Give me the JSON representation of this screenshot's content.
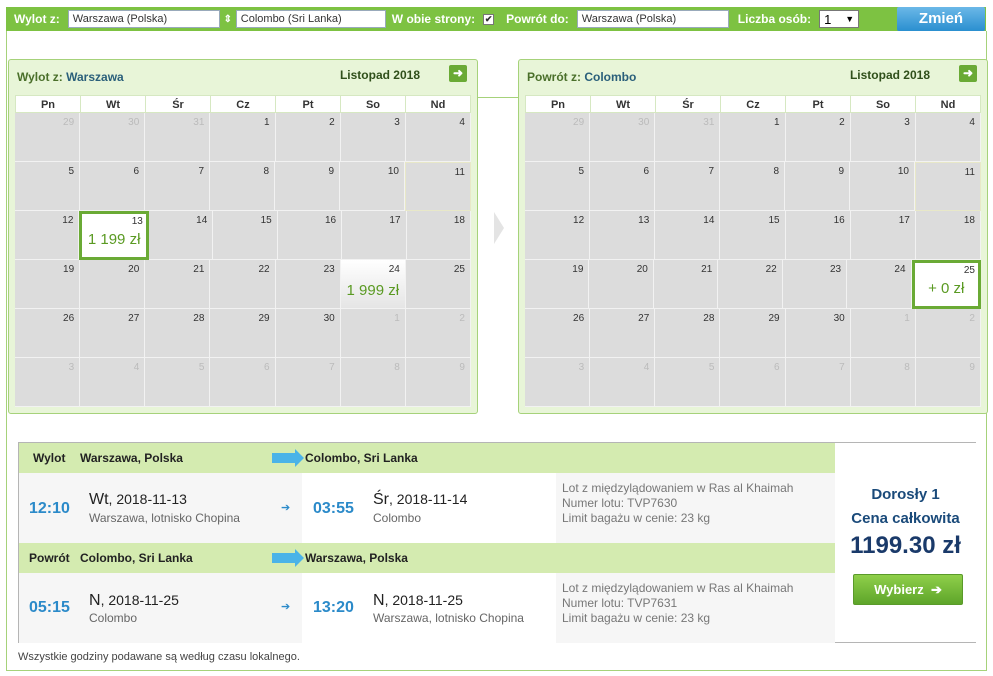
{
  "search": {
    "from_label": "Wylot z:",
    "from_value": "Warszawa (Polska)",
    "to_value": "Colombo (Sri Lanka)",
    "roundtrip_label": "W obie strony:",
    "return_label": "Powrót do:",
    "return_value": "Warszawa (Polska)",
    "persons_label": "Liczba osób:",
    "persons_value": "1",
    "submit_label": "Zmień"
  },
  "cal_out": {
    "title_prefix": "Wylot z: ",
    "title_city": "Warszawa",
    "month": "Listopad 2018",
    "days": [
      "Pn",
      "Wt",
      "Śr",
      "Cz",
      "Pt",
      "So",
      "Nd"
    ],
    "weeks": [
      [
        {
          "d": "29",
          "o": true
        },
        {
          "d": "30",
          "o": true
        },
        {
          "d": "31",
          "o": true
        },
        {
          "d": "1"
        },
        {
          "d": "2"
        },
        {
          "d": "3"
        },
        {
          "d": "4"
        }
      ],
      [
        {
          "d": "5"
        },
        {
          "d": "6"
        },
        {
          "d": "7"
        },
        {
          "d": "8"
        },
        {
          "d": "9"
        },
        {
          "d": "10"
        },
        {
          "d": "11",
          "hl": true
        }
      ],
      [
        {
          "d": "12"
        },
        {
          "d": "13",
          "sel": true,
          "p": "1 199 zł"
        },
        {
          "d": "14"
        },
        {
          "d": "15"
        },
        {
          "d": "16"
        },
        {
          "d": "17"
        },
        {
          "d": "18"
        }
      ],
      [
        {
          "d": "19"
        },
        {
          "d": "20"
        },
        {
          "d": "21"
        },
        {
          "d": "22"
        },
        {
          "d": "23"
        },
        {
          "d": "24",
          "price": true,
          "p": "1 999 zł"
        },
        {
          "d": "25"
        }
      ],
      [
        {
          "d": "26"
        },
        {
          "d": "27"
        },
        {
          "d": "28"
        },
        {
          "d": "29"
        },
        {
          "d": "30"
        },
        {
          "d": "1",
          "o": true
        },
        {
          "d": "2",
          "o": true
        }
      ],
      [
        {
          "d": "3",
          "o": true
        },
        {
          "d": "4",
          "o": true
        },
        {
          "d": "5",
          "o": true
        },
        {
          "d": "6",
          "o": true
        },
        {
          "d": "7",
          "o": true
        },
        {
          "d": "8",
          "o": true
        },
        {
          "d": "9",
          "o": true
        }
      ]
    ]
  },
  "cal_ret": {
    "title_prefix": "Powrót z: ",
    "title_city": "Colombo",
    "month": "Listopad 2018",
    "days": [
      "Pn",
      "Wt",
      "Śr",
      "Cz",
      "Pt",
      "So",
      "Nd"
    ],
    "weeks": [
      [
        {
          "d": "29",
          "o": true
        },
        {
          "d": "30",
          "o": true
        },
        {
          "d": "31",
          "o": true
        },
        {
          "d": "1"
        },
        {
          "d": "2"
        },
        {
          "d": "3"
        },
        {
          "d": "4"
        }
      ],
      [
        {
          "d": "5"
        },
        {
          "d": "6"
        },
        {
          "d": "7"
        },
        {
          "d": "8"
        },
        {
          "d": "9"
        },
        {
          "d": "10"
        },
        {
          "d": "11",
          "hl": true
        }
      ],
      [
        {
          "d": "12"
        },
        {
          "d": "13"
        },
        {
          "d": "14"
        },
        {
          "d": "15"
        },
        {
          "d": "16"
        },
        {
          "d": "17"
        },
        {
          "d": "18"
        }
      ],
      [
        {
          "d": "19"
        },
        {
          "d": "20"
        },
        {
          "d": "21"
        },
        {
          "d": "22"
        },
        {
          "d": "23"
        },
        {
          "d": "24"
        },
        {
          "d": "25",
          "sel": true,
          "p": "+ 0 zł"
        }
      ],
      [
        {
          "d": "26"
        },
        {
          "d": "27"
        },
        {
          "d": "28"
        },
        {
          "d": "29"
        },
        {
          "d": "30"
        },
        {
          "d": "1",
          "o": true
        },
        {
          "d": "2",
          "o": true
        }
      ],
      [
        {
          "d": "3",
          "o": true
        },
        {
          "d": "4",
          "o": true
        },
        {
          "d": "5",
          "o": true
        },
        {
          "d": "6",
          "o": true
        },
        {
          "d": "7",
          "o": true
        },
        {
          "d": "8",
          "o": true
        },
        {
          "d": "9",
          "o": true
        }
      ]
    ]
  },
  "outbound": {
    "label": "Wylot",
    "from": "Warszawa, Polska",
    "to": "Colombo, Sri Lanka",
    "dep_time": "12:10",
    "dep_day": "Wt",
    "dep_date": ", 2018-11-13",
    "dep_place": "Warszawa, lotnisko Chopina",
    "arr_time": "03:55",
    "arr_day": "Śr",
    "arr_date": ", 2018-11-14",
    "arr_place": "Colombo",
    "info1": "Lot z międzylądowaniem w Ras al Khaimah",
    "info2": "Numer lotu: TVP7630",
    "info3": "Limit bagażu w cenie: 23 kg"
  },
  "inbound": {
    "label": "Powrót",
    "from": "Colombo, Sri Lanka",
    "to": "Warszawa, Polska",
    "dep_time": "05:15",
    "dep_day": "N",
    "dep_date": ", 2018-11-25",
    "dep_place": "Colombo",
    "arr_time": "13:20",
    "arr_day": "N",
    "arr_date": ", 2018-11-25",
    "arr_place": "Warszawa, lotnisko Chopina",
    "info1": "Lot z międzylądowaniem w Ras al Khaimah",
    "info2": "Numer lotu: TVP7631",
    "info3": "Limit bagażu w cenie: 23 kg"
  },
  "price": {
    "line1": "Dorosły 1",
    "line2": "Cena całkowita",
    "total": "1199.30 zł",
    "button": "Wybierz"
  },
  "note": "Wszystkie godziny podawane są według czasu lokalnego."
}
